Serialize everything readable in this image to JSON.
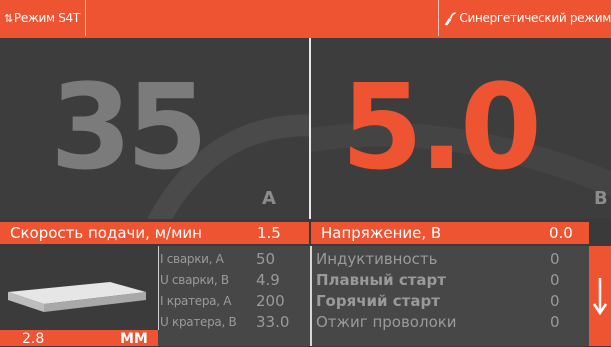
{
  "top_bar": {
    "mode_icon": "up-down-arrows-icon",
    "mode_label": "Режим S4T",
    "synergic_icon": "torch-icon",
    "synergic_label": "Синергетический режим"
  },
  "left_panel": {
    "value": "35",
    "unit": "A"
  },
  "right_panel": {
    "value": "5.0",
    "unit": "B"
  },
  "params": {
    "wire_speed_label": "Скорость подачи, м/мин",
    "wire_speed_value": "1.5",
    "voltage_label": "Напряжение, В",
    "voltage_value": "0.0"
  },
  "thickness": {
    "value": "2.8",
    "unit": "ММ"
  },
  "mid_rows": [
    {
      "label": "I сварки, А",
      "value": "50"
    },
    {
      "label": "U сварки, В",
      "value": "4.9"
    },
    {
      "label": "I кратера, А",
      "value": "200"
    },
    {
      "label": "U кратера, В",
      "value": "33.0"
    }
  ],
  "right_rows": [
    {
      "label": "Индуктивность",
      "value": "0"
    },
    {
      "label": "Плавный старт",
      "value": "0"
    },
    {
      "label": "Горячий старт",
      "value": "0"
    },
    {
      "label": "Отжиг проволоки",
      "value": "0"
    }
  ],
  "scroll_icon": "arrow-down-icon",
  "colors": {
    "accent": "#ee5432",
    "panel": "#3d3d3d",
    "dim_text": "#9a9a9a"
  }
}
